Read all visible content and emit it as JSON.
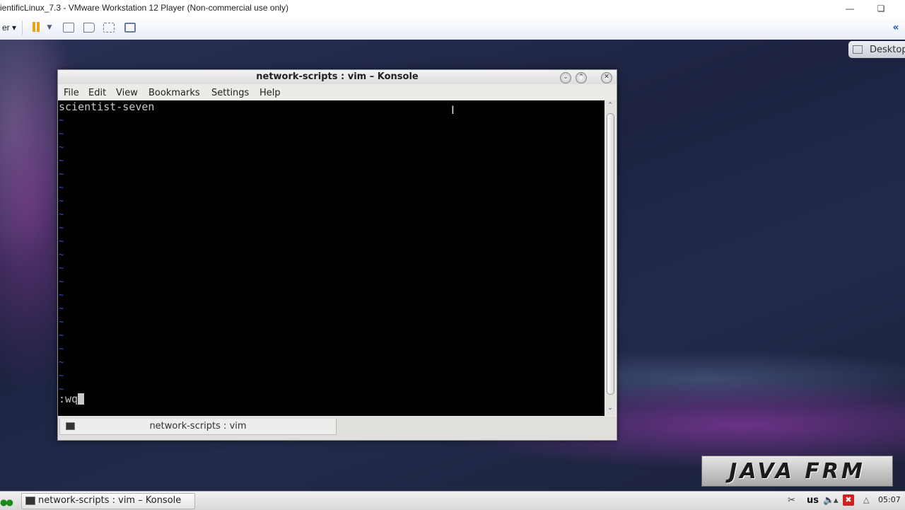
{
  "vm": {
    "title": "ientificLinux_7.3 - VMware Workstation 12 Player (Non-commercial use only)",
    "player_menu_label": "er ▾",
    "toolbar_icons": [
      "pause-icon",
      "dropdown-icon",
      "send-ctrl-alt-del-icon",
      "removable-devices-icon",
      "full-screen-icon",
      "unity-icon",
      "collapse-icon"
    ]
  },
  "desktop": {
    "desktop_button_label": "Desktop",
    "watermark_text": "JAVA FRM"
  },
  "konsole": {
    "title": "network-scripts : vim – Konsole",
    "menu": [
      "File",
      "Edit",
      "View",
      "Bookmarks",
      "Settings",
      "Help"
    ],
    "first_line": "scientist-seven",
    "tilde_char": "~",
    "command_line": ":wq",
    "tab_label": "network-scripts : vim"
  },
  "panel": {
    "task_label": "network-scripts : vim – Konsole",
    "keyboard_layout": "us",
    "clock": "05:07"
  },
  "colors": {
    "vim_tilde": "#3a52c8",
    "terminal_bg": "#000000",
    "terminal_fg": "#c8c8c8",
    "pause_orange": "#e7a21c"
  }
}
